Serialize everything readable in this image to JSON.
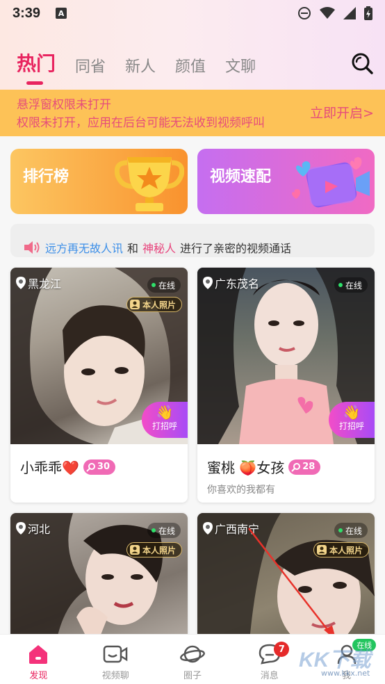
{
  "status_bar": {
    "time": "3:39",
    "a_icon": "A"
  },
  "tabs": [
    {
      "label": "热门",
      "active": true
    },
    {
      "label": "同省"
    },
    {
      "label": "新人"
    },
    {
      "label": "颜值"
    },
    {
      "label": "文聊"
    }
  ],
  "notice": {
    "line1": "悬浮窗权限未打开",
    "line2": "权限未打开，应用在后台可能无法收到视频呼叫",
    "action": "立即开启>"
  },
  "features": {
    "rank_label": "排行榜",
    "video_label": "视频速配"
  },
  "broadcast": {
    "user1": "远方再无故人讯",
    "and": "和",
    "user2": "神秘人",
    "text": "进行了亲密的视频通话"
  },
  "cards": [
    {
      "location": "黑龙江",
      "online": "在线",
      "verified": "本人照片",
      "greet": "打招呼",
      "name": "小乖乖❤️",
      "level": "30",
      "sub": ""
    },
    {
      "location": "广东茂名",
      "online": "在线",
      "verified": "本人照片",
      "greet": "打招呼",
      "name": "蜜桃 🍑女孩",
      "level": "28",
      "sub": "你喜欢的我都有"
    },
    {
      "location": "河北",
      "online": "在线",
      "verified": "本人照片"
    },
    {
      "location": "广西南宁",
      "online": "在线",
      "verified": "本人照片"
    }
  ],
  "nav": [
    {
      "label": "发现",
      "icon": "home-icon",
      "active": true
    },
    {
      "label": "视频聊",
      "icon": "video-camera-icon"
    },
    {
      "label": "圈子",
      "icon": "planet-icon"
    },
    {
      "label": "消息",
      "icon": "chat-bubble-icon",
      "badge": "7"
    },
    {
      "label": "我",
      "icon": "user-icon",
      "status": "在线"
    }
  ],
  "watermark": {
    "logo": "KK下载",
    "url": "www.kkx.net"
  },
  "colors": {
    "accent": "#e8245f",
    "notice_bg": "#fdc257",
    "notice_text": "#e64d7a",
    "online_green": "#22c55e"
  }
}
